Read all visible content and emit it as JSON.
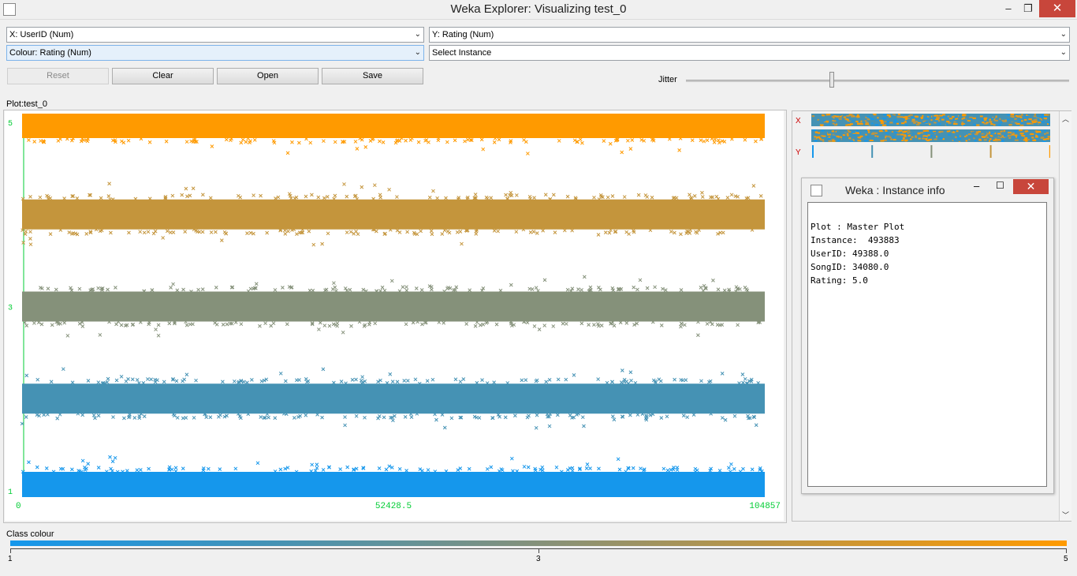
{
  "window": {
    "title": "Weka Explorer: Visualizing test_0",
    "min": "–",
    "restore": "❐",
    "close": "✕"
  },
  "controls": {
    "x_axis": "X: UserID (Num)",
    "y_axis": "Y: Rating (Num)",
    "colour": "Colour: Rating (Num)",
    "select_instance": "Select Instance",
    "reset": "Reset",
    "clear": "Clear",
    "open": "Open",
    "save": "Save",
    "jitter": "Jitter",
    "jitter_level": 0.38
  },
  "plot": {
    "title": "Plot:test_0"
  },
  "side": {
    "x_label": "X",
    "y_label": "Y"
  },
  "instance_info": {
    "title": "Weka : Instance info",
    "lines": [
      "Plot : Master Plot",
      "Instance:  493883",
      "UserID: 49388.0",
      "SongID: 34080.0",
      "Rating: 5.0"
    ]
  },
  "class_colour": {
    "label": "Class colour",
    "ticks": [
      "1",
      "3",
      "5"
    ]
  },
  "colors": {
    "r1": "#1597ec",
    "r2": "#4592b4",
    "r3": "#85917a",
    "r4": "#c4953c",
    "r5": "#ff9a00",
    "axis": "#00cc33"
  },
  "chart_data": {
    "type": "scatter",
    "xlabel": "UserID",
    "ylabel": "Rating",
    "x_ticks": [
      "0",
      "52428.5",
      "104857"
    ],
    "y_ticks": [
      "5",
      "3",
      "1"
    ],
    "xlim": [
      0,
      104857
    ],
    "ylim": [
      1,
      5
    ],
    "grid": false,
    "series": [
      {
        "rating": 1,
        "x_range": [
          0,
          104857
        ],
        "color": "#1597ec"
      },
      {
        "rating": 2,
        "x_range": [
          0,
          104857
        ],
        "color": "#4592b4"
      },
      {
        "rating": 3,
        "x_range": [
          0,
          104857
        ],
        "color": "#85917a"
      },
      {
        "rating": 4,
        "x_range": [
          0,
          104857
        ],
        "color": "#c4953c"
      },
      {
        "rating": 5,
        "x_range": [
          0,
          104857
        ],
        "color": "#ff9a00"
      }
    ]
  }
}
